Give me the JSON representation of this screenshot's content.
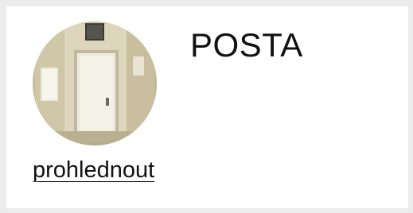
{
  "card": {
    "title": "POSTA",
    "link_label": "prohlednout",
    "avatar_icon": "door-photo-icon"
  },
  "colors": {
    "page_background": "#ececec",
    "card_background": "#ffffff",
    "text": "#111111"
  }
}
